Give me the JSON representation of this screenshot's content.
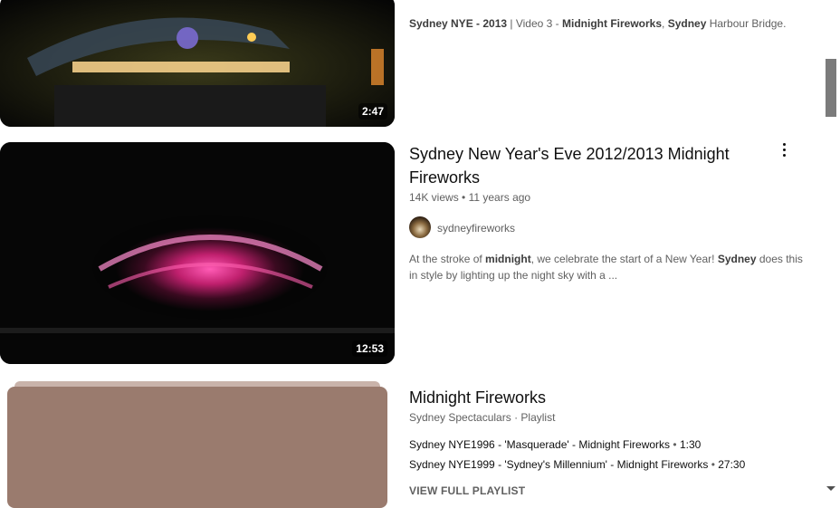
{
  "videos": [
    {
      "duration": "2:47",
      "description_segments": [
        {
          "text": "Sydney NYE - 2013",
          "bold": true
        },
        {
          "text": " | Video 3 - ",
          "bold": false
        },
        {
          "text": "Midnight Fireworks",
          "bold": true
        },
        {
          "text": ", ",
          "bold": false
        },
        {
          "text": "Sydney",
          "bold": true
        },
        {
          "text": " Harbour Bridge.",
          "bold": false
        }
      ]
    },
    {
      "title_line1": "Sydney New Year's Eve 2012/2013 Midnight",
      "title_line2": "Fireworks",
      "views": "14K views",
      "age": "11 years ago",
      "channel": "sydneyfireworks",
      "duration": "12:53",
      "description_line1_segments": [
        {
          "text": "At the stroke of ",
          "bold": false
        },
        {
          "text": "midnight",
          "bold": true
        },
        {
          "text": ", we celebrate the start of a New Year! ",
          "bold": false
        },
        {
          "text": "Sydney",
          "bold": true
        },
        {
          "text": " does this",
          "bold": false
        }
      ],
      "description_line2": "in style by lighting up the night sky with a ..."
    }
  ],
  "playlist": {
    "title": "Midnight Fireworks",
    "meta": "Sydney Spectaculars · Playlist",
    "items": [
      {
        "title": "Sydney NYE1996 - 'Masquerade' - Midnight Fireworks",
        "duration": "1:30"
      },
      {
        "title": "Sydney NYE1999 - 'Sydney's Millennium' - Midnight Fireworks",
        "duration": "27:30"
      }
    ],
    "view_full": "VIEW FULL PLAYLIST"
  },
  "icons": {
    "more": "more-vert-icon",
    "scroll_down": "chevron-down-icon"
  },
  "colors": {
    "playlist_thumb": "#9a7b6e",
    "firework_pink": "#ff3ca0"
  }
}
